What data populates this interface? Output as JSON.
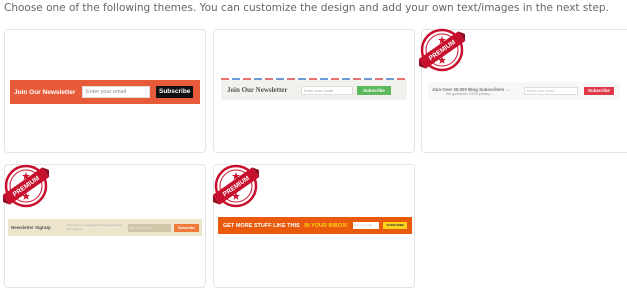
{
  "instruction": "Choose one of the following themes. You can customize the design and add your own text/images in the next step.",
  "badge_text": "PREMIUM",
  "themes": [
    {
      "label": "Join Our Newsletter",
      "placeholder": "Enter your email",
      "button": "Subscribe",
      "premium": false
    },
    {
      "label": "Join Our Newsletter",
      "placeholder": "Enter your email",
      "button": "Subscribe",
      "premium": false
    },
    {
      "label": "Join Over 20,000 Blog Subscribers →",
      "sublabel": "We guarantee 100% privacy...",
      "placeholder": "Enter your email",
      "button": "Subscribe",
      "premium": true
    },
    {
      "label": "Newsletter SignUp",
      "description": "Subscribe to our mailing list to get interesting stuff updates",
      "placeholder": "Enter your email",
      "button": "Subscribe",
      "premium": true
    },
    {
      "label": "GET MORE STUFF LIKE THIS",
      "highlight": "IN YOUR INBOX!",
      "placeholder": "Enter your email",
      "button": "SUBSCRIBE",
      "premium": true
    }
  ],
  "colors": {
    "badge_red": "#c8102e",
    "theme1_bar": "#e85b3a",
    "theme2_button": "#5cb85c",
    "theme3_button": "#e0394a",
    "theme4_bar": "#ede4cc",
    "theme5_bar": "#e95a0c"
  }
}
